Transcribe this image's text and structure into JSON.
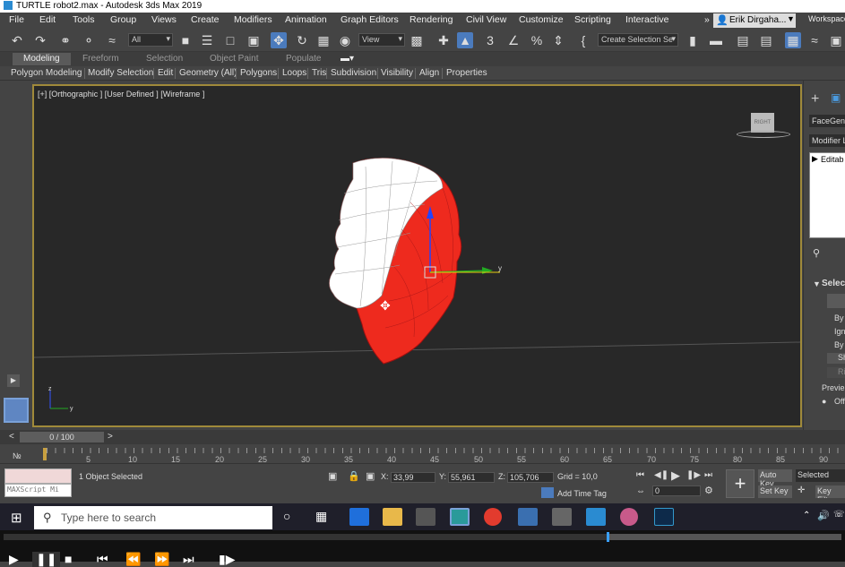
{
  "title_bar": {
    "text": "TURTLE robot2.max - Autodesk 3ds Max 2019"
  },
  "menu": [
    "File",
    "Edit",
    "Tools",
    "Group",
    "Views",
    "Create",
    "Modifiers",
    "Animation",
    "Graph Editors",
    "Rendering",
    "Civil View",
    "Customize",
    "Scripting",
    "Interactive"
  ],
  "menu_right": {
    "user": "Erik Dirgaha...",
    "workspace": "Workspace"
  },
  "toolbar": {
    "filter": "All",
    "view": "View",
    "selection_set": "Create Selection Se"
  },
  "ribbon_tabs": [
    "Modeling",
    "Freeform",
    "Selection",
    "Object Paint",
    "Populate"
  ],
  "ribbon_items": [
    "Polygon Modeling",
    "Modify Selection",
    "Edit",
    "Geometry (All)",
    "Polygons",
    "Loops",
    "Tris",
    "Subdivision",
    "Visibility",
    "Align",
    "Properties"
  ],
  "viewport": {
    "label": "[+] [Orthographic ] [User Defined ] [Wireframe ]",
    "viewcube_text": "RIGHT",
    "axis_x": "x",
    "axis_y": "y",
    "gizmo_y": "y"
  },
  "right_panel": {
    "facegen": "FaceGen",
    "modifier_list": "Modifier Li",
    "editable": "Editab",
    "selection": "Select",
    "by1": "By",
    "ign": "Ign",
    "by2": "By",
    "sh": "Sh",
    "ri": "Ri",
    "preview": "Previe",
    "off": "Off"
  },
  "timeline": {
    "frame": "0 / 100",
    "ticks": [
      "5",
      "10",
      "15",
      "20",
      "25",
      "30",
      "35",
      "40",
      "45",
      "50",
      "55",
      "60",
      "65",
      "70",
      "75",
      "80",
      "85",
      "90"
    ]
  },
  "status": {
    "maxscript": "MAXScript Mi",
    "selected": "1 Object Selected",
    "x_label": "X:",
    "x": "33,99",
    "y_label": "Y:",
    "y": "55,961",
    "z_label": "Z:",
    "z": "105,706",
    "grid": "Grid = 10,0",
    "add_time_tag": "Add Time Tag",
    "auto_key": "Auto Key",
    "set_key": "Set Key",
    "selected_dd": "Selected",
    "key_filters": "Key Filt",
    "frame_field": "0"
  },
  "taskbar": {
    "search_placeholder": "Type here to search"
  },
  "player": {
    "progress": 0.72
  },
  "colors": {
    "accent_blue": "#4b7bbd",
    "viewport_border": "#a08a3a",
    "mesh_red": "#ee2a1e"
  }
}
